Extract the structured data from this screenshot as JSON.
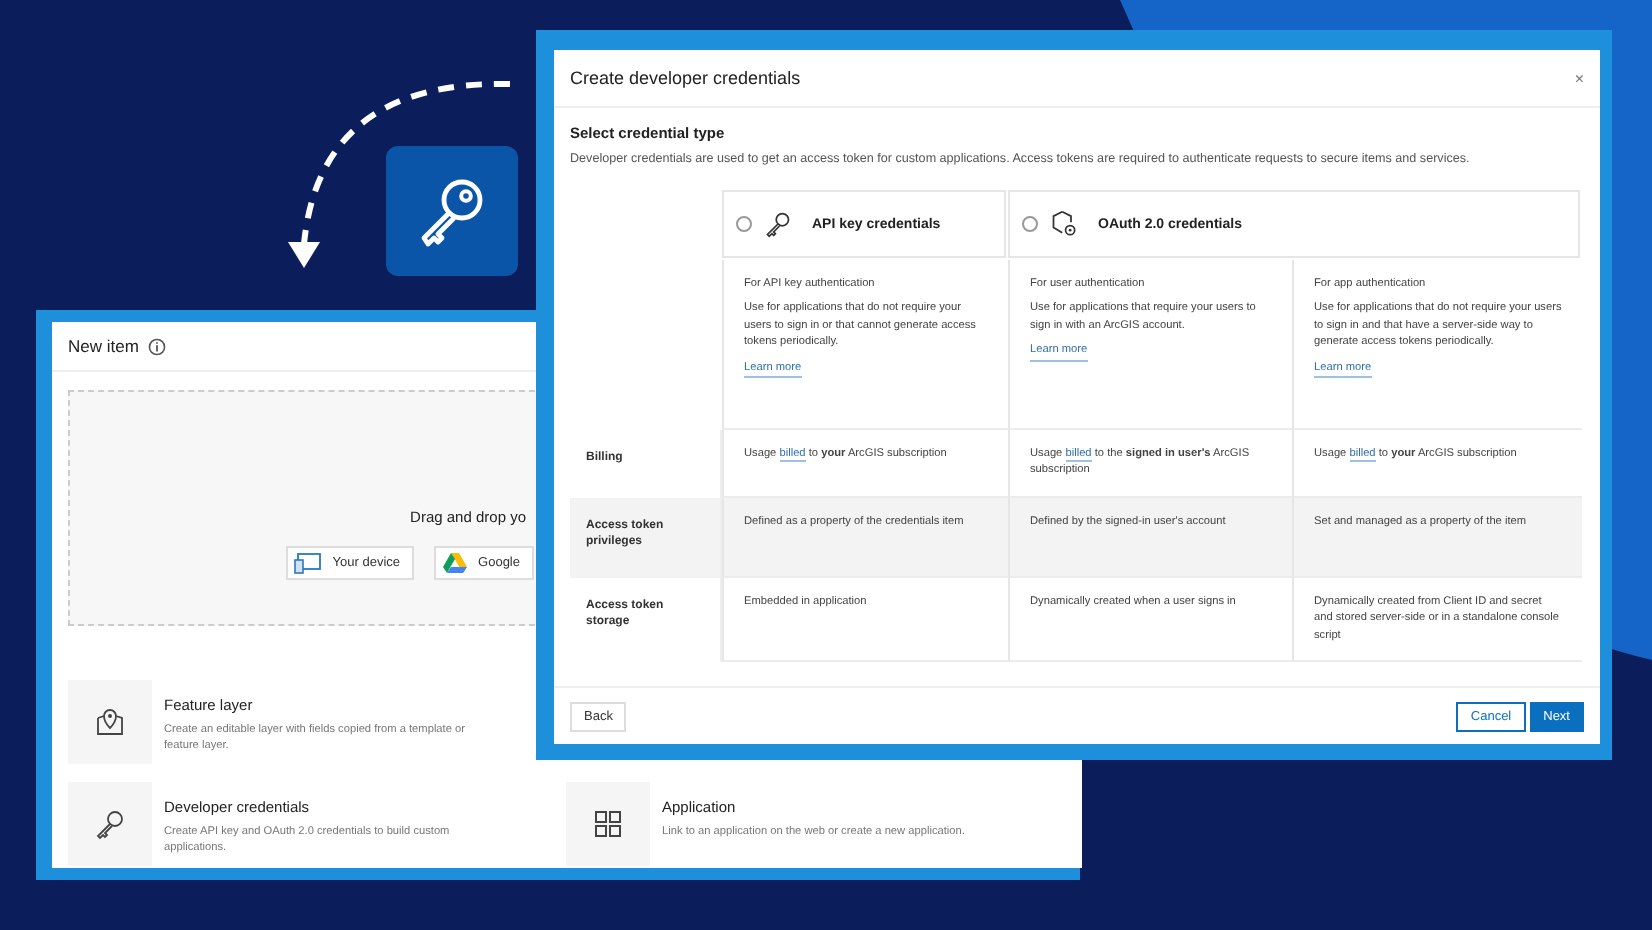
{
  "new_item_window": {
    "title": "New item",
    "dropzone": {
      "text": "Drag and drop yo",
      "buttons": [
        {
          "label": "Your device",
          "kind": "device"
        },
        {
          "label": "Google",
          "kind": "drive"
        }
      ]
    },
    "items": [
      {
        "kind": "layer",
        "title": "Feature layer",
        "description": "Create an editable layer with fields copied from a template or feature layer."
      },
      {
        "kind": "key",
        "title": "Developer credentials",
        "description": "Create API key and OAuth 2.0 credentials to build custom applications."
      },
      {
        "kind": "grid",
        "title": "Application",
        "description": "Link to an application on the web or create a new application."
      }
    ]
  },
  "credentials_dialog": {
    "title": "Create developer credentials",
    "close": "×",
    "section_title": "Select credential type",
    "intro": "Developer credentials are used to get an access token for custom applications. Access tokens are required to authenticate requests to secure items and services.",
    "options": [
      {
        "label": "API key credentials",
        "kind": "key",
        "selected": false
      },
      {
        "label": "OAuth 2.0 credentials",
        "kind": "oauth",
        "selected": false
      }
    ],
    "auth_types": [
      {
        "heading": "For API key authentication",
        "text": "Use for applications that do not require your users to sign in or that cannot generate access tokens periodically.",
        "link": "Learn more"
      },
      {
        "heading": "For user authentication",
        "text": "Use for applications that require your users to sign in with an ArcGIS account.",
        "link": "Learn more"
      },
      {
        "heading": "For app authentication",
        "text": "Use for applications that do not require your users to sign in and that have a server-side way to generate access tokens periodically.",
        "link": "Learn more"
      }
    ],
    "rows": [
      {
        "label": "Billing",
        "shaded": false,
        "cells": [
          [
            {
              "kind": "text",
              "text": "Usage "
            },
            {
              "kind": "link",
              "text": "billed"
            },
            {
              "kind": "text",
              "text": " to **your** ArcGIS subscription"
            }
          ],
          [
            {
              "kind": "text",
              "text": "Usage "
            },
            {
              "kind": "link",
              "text": "billed"
            },
            {
              "kind": "text",
              "text": " to the **signed in user's** ArcGIS subscription"
            }
          ],
          [
            {
              "kind": "text",
              "text": "Usage "
            },
            {
              "kind": "link",
              "text": "billed"
            },
            {
              "kind": "text",
              "text": " to **your** ArcGIS subscription"
            }
          ]
        ]
      },
      {
        "label": "Access token privileges",
        "shaded": true,
        "cells": [
          [
            {
              "kind": "text",
              "text": "Defined as a property of the credentials item"
            }
          ],
          [
            {
              "kind": "text",
              "text": "Defined by the signed-in user's account"
            }
          ],
          [
            {
              "kind": "text",
              "text": "Set and managed as a property of the item"
            }
          ]
        ]
      },
      {
        "label": "Access token storage",
        "shaded": false,
        "cells": [
          [
            {
              "kind": "text",
              "text": "Embedded in application"
            }
          ],
          [
            {
              "kind": "text",
              "text": "Dynamically created when a user signs in"
            }
          ],
          [
            {
              "kind": "text",
              "text": "Dynamically created from Client ID and secret and stored server-side or in a standalone console script"
            }
          ]
        ]
      }
    ],
    "buttons": {
      "back": "Back",
      "cancel": "Cancel",
      "next": "Next"
    }
  }
}
